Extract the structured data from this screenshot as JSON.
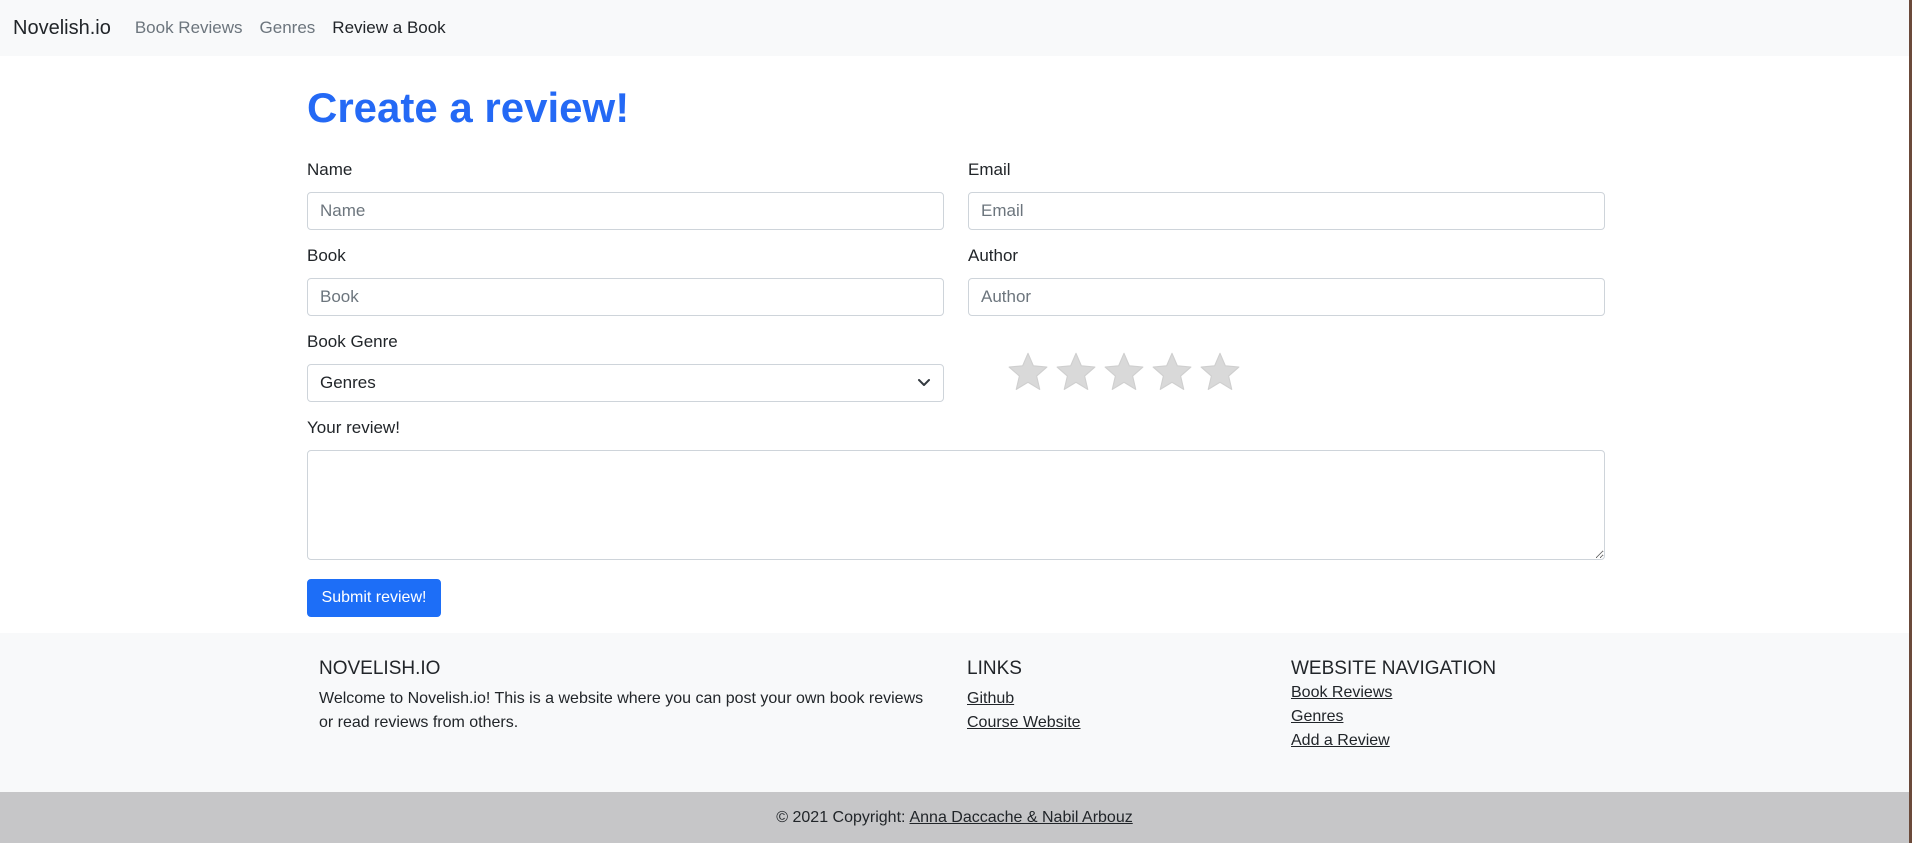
{
  "navbar": {
    "brand": "Novelish.io",
    "links": [
      {
        "label": "Book Reviews",
        "active": false
      },
      {
        "label": "Genres",
        "active": false
      },
      {
        "label": "Review a Book",
        "active": true
      }
    ]
  },
  "form": {
    "title": "Create a review!",
    "name": {
      "label": "Name",
      "placeholder": "Name"
    },
    "email": {
      "label": "Email",
      "placeholder": "Email"
    },
    "book": {
      "label": "Book",
      "placeholder": "Book"
    },
    "author": {
      "label": "Author",
      "placeholder": "Author"
    },
    "genre": {
      "label": "Book Genre",
      "selected": "Genres"
    },
    "rating": {
      "max": 5,
      "value": 0,
      "star_color": "#d9d9d9",
      "icon": "star-icon"
    },
    "review": {
      "label": "Your review!",
      "value": ""
    },
    "submit_label": "Submit review!"
  },
  "footer": {
    "about": {
      "heading": "NOVELISH.IO",
      "text": "Welcome to Novelish.io! This is a website where you can post your own book reviews or read reviews from others."
    },
    "links": {
      "heading": "LINKS",
      "items": [
        "Github",
        "Course Website"
      ]
    },
    "navigation": {
      "heading": "WEBSITE NAVIGATION",
      "items": [
        "Book Reviews",
        "Genres",
        "Add a Review"
      ]
    },
    "copyright_prefix": "© 2021 Copyright:",
    "copyright_authors": "Anna Daccache & Nabil Arbouz"
  },
  "colors": {
    "accent": "#2469f5",
    "navbar_bg": "#f8f9fa",
    "copyright_bg": "#c6c6c8"
  }
}
